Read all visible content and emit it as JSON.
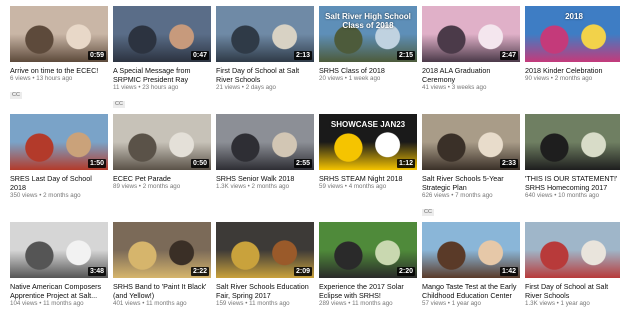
{
  "videos": [
    {
      "title": "Arrive on time to the ECEC!",
      "duration": "0:59",
      "views": "6 views",
      "age": "13 hours ago",
      "badge": "CC",
      "colors": [
        "#c9b6a6",
        "#5d4a3b",
        "#e8d8c8"
      ]
    },
    {
      "title": "A Special Message from SRPMIC President Ray",
      "duration": "0:47",
      "views": "11 views",
      "age": "23 hours ago",
      "badge": "CC",
      "colors": [
        "#5a6d88",
        "#2c3340",
        "#c79a7c"
      ]
    },
    {
      "title": "First Day of School at Salt River Schools",
      "duration": "2:13",
      "views": "21 views",
      "age": "2 days ago",
      "badge": "",
      "colors": [
        "#6f8aa6",
        "#2f3a47",
        "#d8d2c4"
      ]
    },
    {
      "title": "SRHS Class of 2018",
      "duration": "2:15",
      "views": "20 views",
      "age": "1 week ago",
      "badge": "",
      "colors": [
        "#5e8fb8",
        "#4d5b3b",
        "#c0d2e0"
      ],
      "overlay": "Salt River High School Class of 2018"
    },
    {
      "title": "2018 ALA Graduation Ceremony",
      "duration": "2:47",
      "views": "41 views",
      "age": "3 weeks ago",
      "badge": "",
      "colors": [
        "#e0b0c8",
        "#4b3a49",
        "#f4e6ee"
      ]
    },
    {
      "title": "2018 Kinder Celebration",
      "duration": "",
      "views": "90 views",
      "age": "2 months ago",
      "badge": "",
      "colors": [
        "#3e7dc4",
        "#c43a7a",
        "#f2d24a"
      ],
      "overlay": "2018"
    },
    {
      "title": "SRES Last Day of School 2018",
      "duration": "1:50",
      "views": "350 views",
      "age": "2 months ago",
      "badge": "",
      "colors": [
        "#7aa3c8",
        "#b33a2a",
        "#caa27a"
      ]
    },
    {
      "title": "ECEC Pet Parade",
      "duration": "0:50",
      "views": "89 views",
      "age": "2 months ago",
      "badge": "",
      "colors": [
        "#c7c2b8",
        "#5a5248",
        "#e4e0d8"
      ]
    },
    {
      "title": "SRHS Senior Walk 2018",
      "duration": "2:55",
      "views": "1.3K views",
      "age": "2 months ago",
      "badge": "",
      "colors": [
        "#8c8f96",
        "#2e2e34",
        "#d2c6b4"
      ]
    },
    {
      "title": "SRHS STEAM Night 2018",
      "duration": "1:12",
      "views": "59 views",
      "age": "4 months ago",
      "badge": "",
      "colors": [
        "#1a1a1a",
        "#f5c400",
        "#ffffff"
      ],
      "overlay": "SHOWCASE JAN23"
    },
    {
      "title": "Salt River Schools 5-Year Strategic Plan",
      "duration": "2:33",
      "views": "626 views",
      "age": "7 months ago",
      "badge": "CC",
      "colors": [
        "#a99c88",
        "#3a3028",
        "#e8dccb"
      ]
    },
    {
      "title": "'THIS IS OUR STATEMENT!' SRHS Homecoming 2017",
      "duration": "",
      "views": "640 views",
      "age": "10 months ago",
      "badge": "",
      "colors": [
        "#6f7f62",
        "#1e1e1e",
        "#d8dcc8"
      ]
    },
    {
      "title": "Native American Composers Apprentice Project at Salt...",
      "duration": "3:48",
      "views": "104 views",
      "age": "11 months ago",
      "badge": "",
      "colors": [
        "#d6d6d6",
        "#555555",
        "#f2f2f2"
      ]
    },
    {
      "title": "SRHS Band to 'Paint It Black' (and Yellow!)",
      "duration": "2:22",
      "views": "401 views",
      "age": "11 months ago",
      "badge": "",
      "colors": [
        "#7b6a58",
        "#d6b56c",
        "#3a2f26"
      ]
    },
    {
      "title": "Salt River Schools Education Fair, Spring 2017",
      "duration": "2:09",
      "views": "159 views",
      "age": "11 months ago",
      "badge": "",
      "colors": [
        "#3d3a37",
        "#c9a23c",
        "#9a5a2a"
      ]
    },
    {
      "title": "Experience the 2017 Solar Eclipse with SRHS!",
      "duration": "2:20",
      "views": "289 views",
      "age": "11 months ago",
      "badge": "",
      "colors": [
        "#4f8a3a",
        "#2a2a2a",
        "#c9d8b0"
      ]
    },
    {
      "title": "Mango Taste Test at the Early Childhood Education Center",
      "duration": "1:42",
      "views": "57 views",
      "age": "1 year ago",
      "badge": "",
      "colors": [
        "#8ab6d8",
        "#5a3a28",
        "#e6c8a8"
      ]
    },
    {
      "title": "First Day of School at Salt River Schools",
      "duration": "",
      "views": "1.3K views",
      "age": "1 year ago",
      "badge": "",
      "colors": [
        "#9fb6c9",
        "#b83a3a",
        "#e9e4dc"
      ]
    }
  ]
}
